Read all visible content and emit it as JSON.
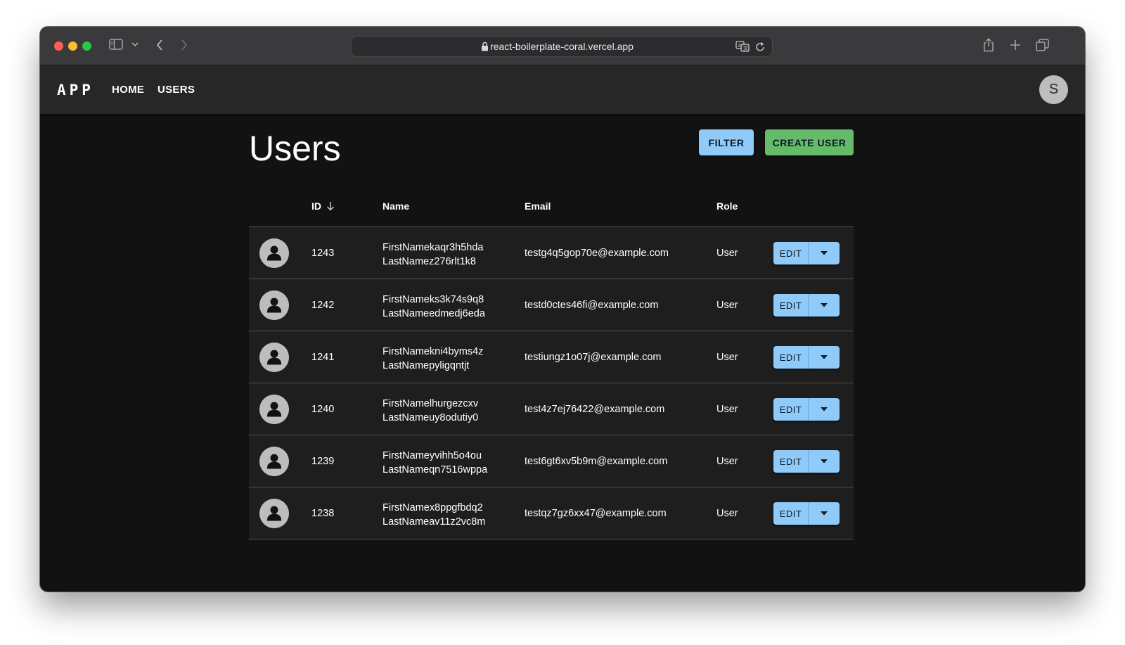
{
  "browser": {
    "url": "react-boilerplate-coral.vercel.app"
  },
  "appbar": {
    "logo": "APP",
    "nav": [
      {
        "label": "HOME"
      },
      {
        "label": "USERS"
      }
    ],
    "profile_initial": "S"
  },
  "page": {
    "title": "Users",
    "filter_label": "FILTER",
    "create_label": "CREATE USER"
  },
  "table": {
    "columns": {
      "id": "ID",
      "name": "Name",
      "email": "Email",
      "role": "Role"
    },
    "sort": {
      "column": "ID",
      "direction": "descending"
    },
    "edit_label": "EDIT",
    "rows": [
      {
        "id": "1243",
        "first": "FirstNamekaqr3h5hda",
        "last": "LastNamez276rlt1k8",
        "email": "testg4q5gop70e@example.com",
        "role": "User"
      },
      {
        "id": "1242",
        "first": "FirstNameks3k74s9q8",
        "last": "LastNameedmedj6eda",
        "email": "testd0ctes46fi@example.com",
        "role": "User"
      },
      {
        "id": "1241",
        "first": "FirstNamekni4byms4z",
        "last": "LastNamepyligqntjt",
        "email": "testiungz1o07j@example.com",
        "role": "User"
      },
      {
        "id": "1240",
        "first": "FirstNamelhurgezcxv",
        "last": "LastNameuy8odutiy0",
        "email": "test4z7ej76422@example.com",
        "role": "User"
      },
      {
        "id": "1239",
        "first": "FirstNameyvihh5o4ou",
        "last": "LastNameqn7516wppa",
        "email": "test6gt6xv5b9m@example.com",
        "role": "User"
      },
      {
        "id": "1238",
        "first": "FirstNamex8ppgfbdq2",
        "last": "LastNameav11z2vc8m",
        "email": "testqz7gz6xx47@example.com",
        "role": "User"
      }
    ]
  }
}
